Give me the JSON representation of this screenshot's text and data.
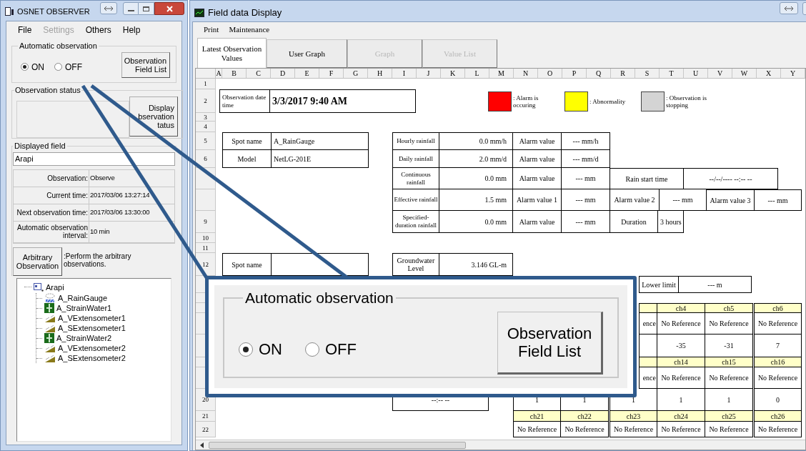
{
  "left_window": {
    "title": "OSNET OBSERVER",
    "menu": [
      {
        "label": "File",
        "disabled": false
      },
      {
        "label": "Settings",
        "disabled": true
      },
      {
        "label": "Others",
        "disabled": false
      },
      {
        "label": "Help",
        "disabled": false
      }
    ],
    "automatic_observation": {
      "legend": "Automatic observation",
      "options": [
        {
          "label": "ON",
          "selected": true
        },
        {
          "label": "OFF",
          "selected": false
        }
      ],
      "button": "Observation Field List"
    },
    "observation_status": {
      "legend": "Observation status",
      "button": "Display bservation tatus"
    },
    "displayed_field": {
      "legend": "Displayed field",
      "value": "Arapi"
    },
    "info": [
      {
        "label": "Observation:",
        "value": "Observe"
      },
      {
        "label": "Current time:",
        "value": "2017/03/06 13:27:14"
      },
      {
        "label": "Next observation time:",
        "value": "2017/03/06 13:30:00"
      },
      {
        "label": "Automatic observation interval:",
        "value": "10 min"
      }
    ],
    "arbitrary": {
      "button": "Arbitrary Observation",
      "description": ":Perform the arbitrary observations."
    },
    "tree": {
      "label": "Arapi",
      "children": [
        {
          "label": "A_RainGauge",
          "kind": "rain_gauge"
        },
        {
          "label": "A_StrainWater1",
          "kind": "water"
        },
        {
          "label": "A_VExtensometer1",
          "kind": "extensometer"
        },
        {
          "label": "A_SExtensometer1",
          "kind": "extensometer"
        },
        {
          "label": "A_StrainWater2",
          "kind": "water"
        },
        {
          "label": "A_VExtensometer2",
          "kind": "extensometer"
        },
        {
          "label": "A_SExtensometer2",
          "kind": "extensometer"
        }
      ]
    }
  },
  "right_window": {
    "title": "Field data Display",
    "menu": [
      "Print",
      "Maintenance"
    ],
    "tabs": [
      {
        "label": "Latest Observation Values",
        "selected": true,
        "disabled": false
      },
      {
        "label": "User Graph",
        "selected": false,
        "disabled": false
      },
      {
        "label": "Graph",
        "selected": false,
        "disabled": true
      },
      {
        "label": "Value List",
        "selected": false,
        "disabled": true
      }
    ],
    "sheet": {
      "columns": [
        "A",
        "B",
        "C",
        "D",
        "E",
        "F",
        "G",
        "H",
        "I",
        "J",
        "K",
        "L",
        "M",
        "N",
        "O",
        "P",
        "Q",
        "R",
        "S",
        "T",
        "U",
        "V",
        "W",
        "X",
        "Y"
      ],
      "row_numbers": [
        "1",
        "2",
        "3",
        "4",
        "5",
        "6",
        "9",
        "10",
        "11",
        "12",
        "20",
        "21",
        "22"
      ],
      "observation_datetime": {
        "label": "Observation date time",
        "value": "3/3/2017 9:40 AM"
      },
      "legend": [
        {
          "label": ": Alarm is occuring",
          "color": "#ff0000"
        },
        {
          "label": ": Abnormality",
          "color": "#ffff00"
        },
        {
          "label": ": Observation is stopping",
          "color": "#d4d4d4"
        }
      ],
      "spot_table": [
        [
          "Spot name",
          "A_RainGauge"
        ],
        [
          "Model",
          "NetLG-201E"
        ]
      ],
      "rainfall": [
        [
          "Hourly rainfall",
          "0.0 mm/h",
          "Alarm value",
          "--- mm/h"
        ],
        [
          "Daily rainfall",
          "2.0 mm/d",
          "Alarm value",
          "--- mm/d"
        ],
        [
          "Continuous rainfall",
          "0.0 mm",
          "Alarm value",
          "--- mm",
          "Rain start time",
          "--/--/---- --:-- --"
        ],
        [
          "Effective rainfall",
          "1.5 mm",
          "Alarm value 1",
          "--- mm",
          "Alarm value 2",
          "--- mm",
          "Alarm value 3",
          "--- mm"
        ],
        [
          "Specified-duration rainfall",
          "0.0 mm",
          "Alarm value",
          "--- mm",
          "Duration",
          "3 hours"
        ]
      ],
      "second_spot_label": "Spot name",
      "groundwater": [
        "Groundwater Level",
        "3.146 GL-m"
      ],
      "lower_limit": [
        "Lower limit",
        "--- m"
      ],
      "time_cell": "--:-- --",
      "channel_rows": [
        {
          "kind": "header",
          "cells": [
            "ch4",
            "ch5",
            "ch6"
          ]
        },
        {
          "kind": "value",
          "fragment": "ence",
          "cells": [
            "No Reference",
            "No Reference",
            "No Reference"
          ]
        },
        {
          "kind": "value",
          "cells": [
            "-35",
            "-31",
            "7"
          ]
        },
        {
          "kind": "header",
          "cells": [
            "ch14",
            "ch15",
            "ch16"
          ]
        },
        {
          "kind": "value",
          "fragment": "ence",
          "cells": [
            "No Reference",
            "No Reference",
            "No Reference"
          ]
        },
        {
          "kind": "value",
          "cells": [
            "1",
            "1",
            "1",
            "1",
            "1",
            "0"
          ]
        },
        {
          "kind": "header",
          "cells": [
            "ch21",
            "ch22",
            "ch23",
            "ch24",
            "ch25",
            "ch26"
          ]
        },
        {
          "kind": "value",
          "cells": [
            "No Reference",
            "No Reference",
            "No Reference",
            "No Reference",
            "No Reference",
            "No Reference"
          ]
        }
      ]
    }
  },
  "callout": {
    "legend": "Automatic observation",
    "options": [
      {
        "label": "ON",
        "selected": true
      },
      {
        "label": "OFF",
        "selected": false
      }
    ],
    "button": "Observation Field List"
  }
}
